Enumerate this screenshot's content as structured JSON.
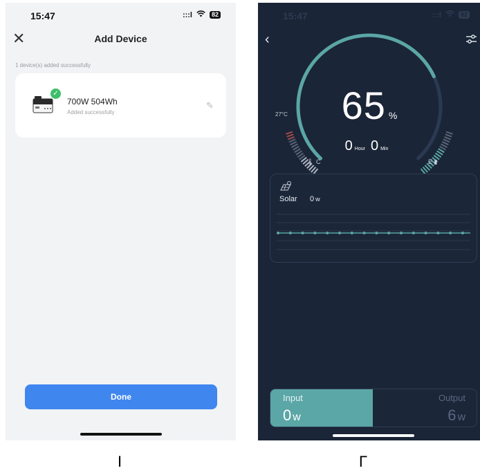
{
  "left": {
    "status": {
      "time": "15:47",
      "signal": ":::l",
      "wifi": "wifi-icon",
      "battery": "82"
    },
    "header": {
      "close_icon": "close-icon",
      "title": "Add Device"
    },
    "message": "1 device(s) added successfully",
    "device": {
      "name": "700W  504Wh",
      "status": "Added successfully",
      "icon": "power-station-icon",
      "check_icon": "check-icon",
      "edit_icon": "edit-icon"
    },
    "done_label": "Done"
  },
  "right": {
    "status": {
      "time": "15:47",
      "signal": ":::l",
      "wifi": "wifi-icon",
      "battery": "82"
    },
    "header": {
      "back_icon": "back-icon",
      "settings_icon": "settings-sliders-icon"
    },
    "battery": {
      "percent": "65",
      "percent_unit": "%",
      "hours": "0",
      "hours_unit": "Hour",
      "minutes": "0",
      "minutes_unit": "Min",
      "level": 0.65
    },
    "temperature": "27°C",
    "gauge_left_label": "C",
    "gauge_right_label": "E",
    "solar": {
      "icon": "solar-panel-icon",
      "label": "Solar",
      "value": "0",
      "unit": "w"
    },
    "input": {
      "label": "Input",
      "value": "0",
      "unit": "w"
    },
    "output": {
      "label": "Output",
      "value": "6",
      "unit": "w"
    }
  },
  "captions": {
    "left": "I",
    "right": "Г"
  },
  "colors": {
    "accent": "#5ba6a6",
    "primary_button": "#3f86ef",
    "dark_bg": "#1a2537",
    "success": "#3fbf6b"
  }
}
